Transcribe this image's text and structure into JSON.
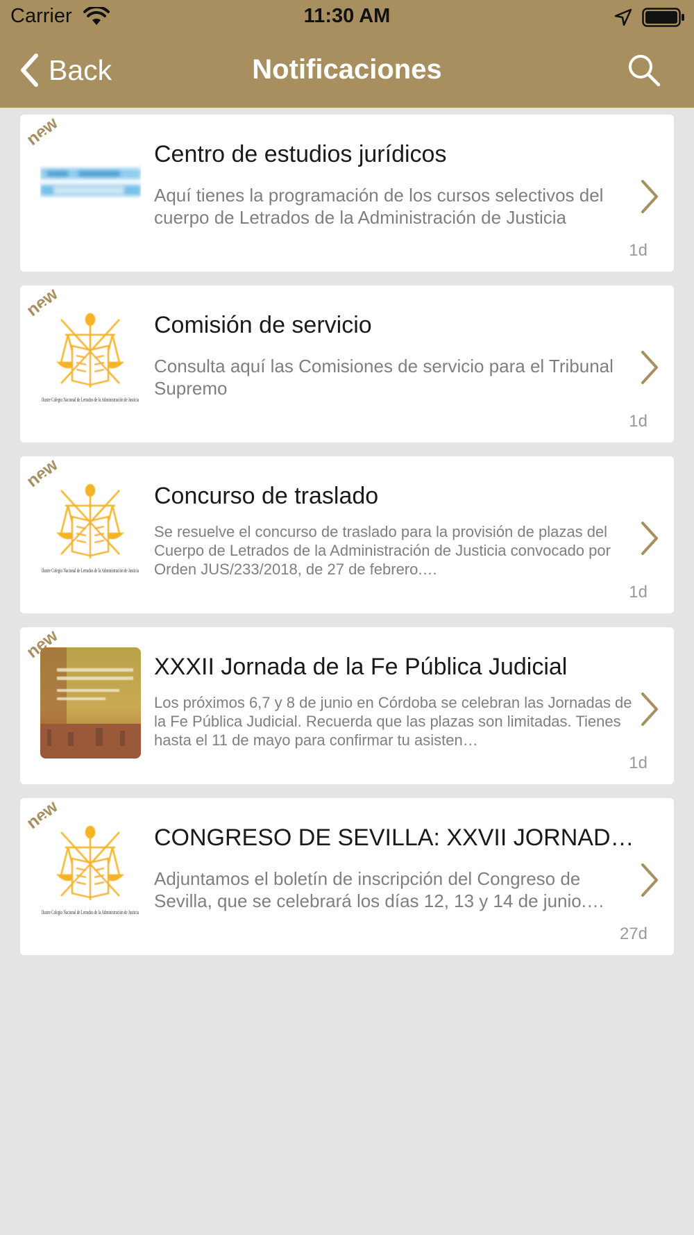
{
  "status_bar": {
    "carrier": "Carrier",
    "time": "11:30 AM"
  },
  "nav": {
    "back_label": "Back",
    "title": "Notificaciones"
  },
  "colors": {
    "accent": "#a88f5f",
    "background": "#e5e4e5"
  },
  "notifications": [
    {
      "badge": "new",
      "title": "Centro de estudios jurídicos",
      "description": "Aquí tienes la programación de los cursos selectivos del cuerpo de Letrados de la Administración de Justicia",
      "time": "1d",
      "thumbnail": "blurred-banner-image"
    },
    {
      "badge": "new",
      "title": "Comisión de servicio",
      "description": "Consulta aquí las Comisiones de servicio para el Tribunal Supremo",
      "time": "1d",
      "thumbnail": "colegio-logo",
      "logo_text": "Ilustre Colegio Nacional de Letrados de la Administración de Justicia"
    },
    {
      "badge": "new",
      "title": "Concurso de traslado",
      "description": "Se resuelve el concurso de traslado para la provisión de plazas del Cuerpo de Letrados de la Administración de Justicia convocado por Orden JUS/233/2018, de 27 de febrero.…",
      "time": "1d",
      "thumbnail": "colegio-logo",
      "logo_text": "Ilustre Colegio Nacional de Letrados de la Administración de Justicia"
    },
    {
      "badge": "new",
      "title": "XXXII Jornada de la Fe Pública Judicial",
      "description": "Los próximos 6,7 y 8 de junio en Córdoba se celebran las Jornadas de la Fe Pública Judicial. Recuerda que las plazas son limitadas. Tienes hasta el 11 de mayo para confirmar tu asisten…",
      "time": "1d",
      "thumbnail": "cordoba-photo"
    },
    {
      "badge": "new",
      "title": "CONGRESO DE SEVILLA: XXVII JORNADAS…",
      "description": "Adjuntamos el boletín de inscripción del Congreso de Sevilla, que se celebrará los días 12, 13 y 14 de junio.…",
      "time": "27d",
      "thumbnail": "colegio-logo",
      "logo_text": "Ilustre Colegio Nacional de Letrados de la Administración de Justicia"
    }
  ]
}
